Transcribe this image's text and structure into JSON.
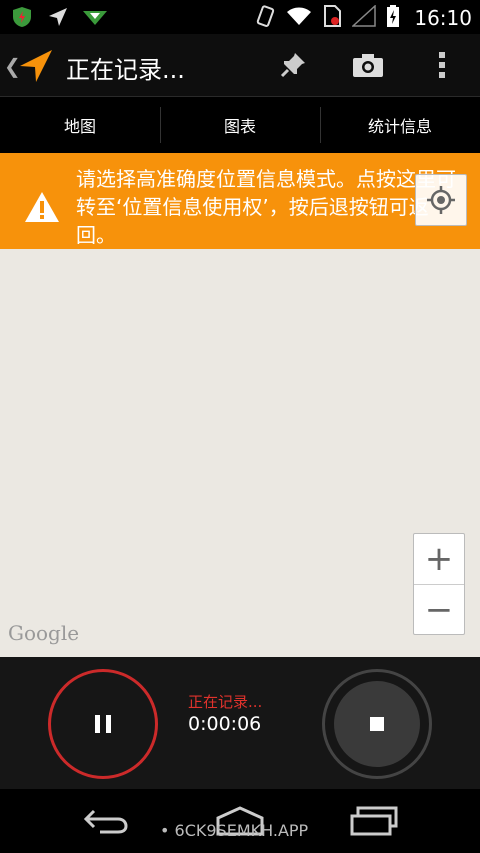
{
  "status_bar": {
    "time": "16:10",
    "left_icons": [
      "shield-app-icon",
      "location-arrow-icon",
      "download-icon"
    ],
    "right_icons": [
      "vibrate-icon",
      "wifi-icon",
      "sim-icon",
      "signal-icon",
      "battery-charging-icon"
    ]
  },
  "action_bar": {
    "title": "正在记录...",
    "actions": [
      "pin-icon",
      "camera-icon",
      "overflow-menu-icon"
    ]
  },
  "tabs": [
    {
      "label": "地图"
    },
    {
      "label": "图表"
    },
    {
      "label": "统计信息"
    }
  ],
  "banner": {
    "text": "请选择高准确度位置信息模式。点按这里可转至‘位置信息使用权’，按后退按钮可返回。"
  },
  "map": {
    "attribution": "Google",
    "zoom_in": "+",
    "zoom_out": "−"
  },
  "recording": {
    "status": "正在记录...",
    "elapsed": "0:00:06"
  },
  "nav_bar": {
    "watermark": "• 6CK9SEMKH.APP"
  },
  "colors": {
    "banner": "#f7920b",
    "record_red": "#cc2a2a",
    "status_red": "#e0322c",
    "map_bg": "#ebe8e2"
  }
}
